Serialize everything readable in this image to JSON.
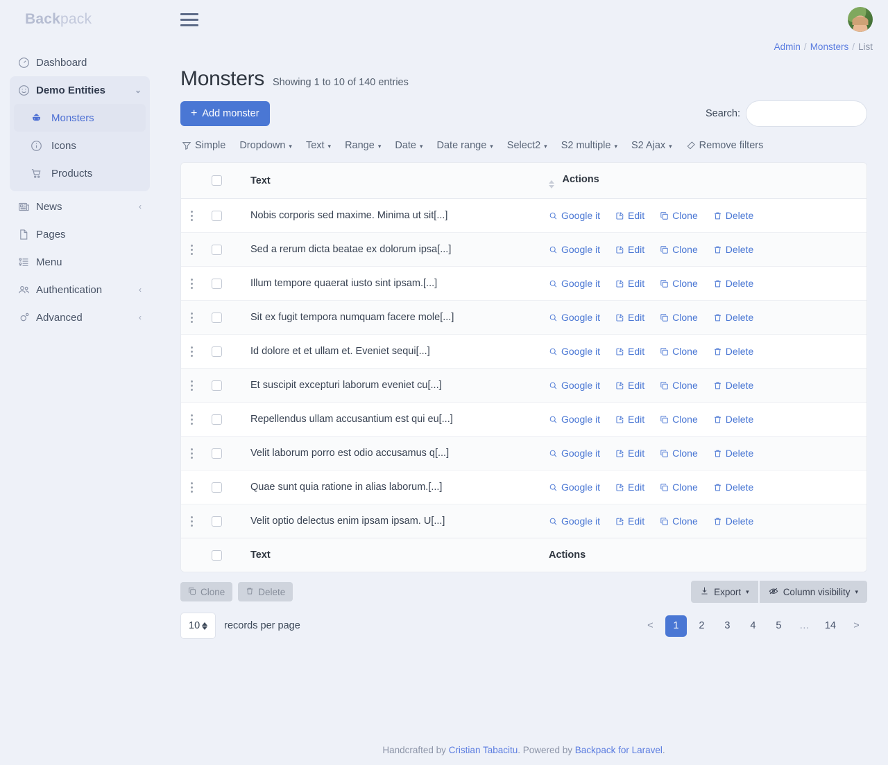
{
  "brand": {
    "strong": "Back",
    "light": "pack"
  },
  "sidebar": {
    "items": [
      {
        "label": "Dashboard",
        "icon": "dashboard-icon"
      },
      {
        "label": "Demo Entities",
        "icon": "smiley-icon",
        "caret": "⌄"
      },
      {
        "label": "News",
        "icon": "newspaper-icon",
        "caret": "‹"
      },
      {
        "label": "Pages",
        "icon": "file-icon"
      },
      {
        "label": "Menu",
        "icon": "list-icon"
      },
      {
        "label": "Authentication",
        "icon": "users-icon",
        "caret": "‹"
      },
      {
        "label": "Advanced",
        "icon": "gear-icon",
        "caret": "‹"
      }
    ],
    "demo_children": [
      {
        "label": "Monsters",
        "icon": "monster-icon",
        "active": true
      },
      {
        "label": "Icons",
        "icon": "info-circle-icon",
        "active": false
      },
      {
        "label": "Products",
        "icon": "cart-icon",
        "active": false
      }
    ]
  },
  "breadcrumb": {
    "admin": "Admin",
    "monsters": "Monsters",
    "current": "List",
    "separator": "/"
  },
  "header": {
    "title": "Monsters",
    "subtitle": "Showing 1 to 10 of 140 entries",
    "add_button": "Add monster",
    "add_plus": "+",
    "search_label": "Search:",
    "search_value": "",
    "search_placeholder": ""
  },
  "filters": [
    {
      "label": "Simple",
      "icon": "filter-icon",
      "caret": ""
    },
    {
      "label": "Dropdown",
      "caret": "▾"
    },
    {
      "label": "Text",
      "caret": "▾"
    },
    {
      "label": "Range",
      "caret": "▾"
    },
    {
      "label": "Date",
      "caret": "▾"
    },
    {
      "label": "Date range",
      "caret": "▾"
    },
    {
      "label": "Select2",
      "caret": "▾"
    },
    {
      "label": "S2 multiple",
      "caret": "▾"
    },
    {
      "label": "S2 Ajax",
      "caret": "▾"
    },
    {
      "label": "Remove filters",
      "icon": "eraser-icon",
      "caret": ""
    }
  ],
  "table": {
    "columns": {
      "text": "Text",
      "actions": "Actions"
    },
    "row_actions": [
      {
        "label": "Google it",
        "icon": "search-icon"
      },
      {
        "label": "Edit",
        "icon": "pencil-square-icon"
      },
      {
        "label": "Clone",
        "icon": "copy-icon"
      },
      {
        "label": "Delete",
        "icon": "trash-icon"
      }
    ],
    "rows": [
      {
        "text": "Nobis corporis sed maxime. Minima ut sit[...]"
      },
      {
        "text": "Sed a rerum dicta beatae ex dolorum ipsa[...]"
      },
      {
        "text": "Illum tempore quaerat iusto sint ipsam.[...]"
      },
      {
        "text": "Sit ex fugit tempora numquam facere mole[...]"
      },
      {
        "text": "Id dolore et et ullam et. Eveniet sequi[...]"
      },
      {
        "text": "Et suscipit excepturi laborum eveniet cu[...]"
      },
      {
        "text": "Repellendus ullam accusantium est qui eu[...]"
      },
      {
        "text": "Velit laborum porro est odio accusamus q[...]"
      },
      {
        "text": "Quae sunt quia ratione in alias laborum.[...]"
      },
      {
        "text": "Velit optio delectus enim ipsam ipsam. U[...]"
      }
    ]
  },
  "bulk": {
    "clone": "Clone",
    "delete": "Delete",
    "export": "Export",
    "column_visibility": "Column visibility",
    "caret": "▾"
  },
  "pagination": {
    "records_per_page_value": "10",
    "records_per_page_label": "records per page",
    "prev": "<",
    "next": ">",
    "gap": "…",
    "pages": [
      "1",
      "2",
      "3",
      "4",
      "5"
    ],
    "last_page": "14",
    "active_page": "1"
  },
  "footer": {
    "prefix": "Handcrafted by ",
    "author": "Cristian Tabacitu",
    "middle": ". Powered by ",
    "product": "Backpack for Laravel",
    "suffix": "."
  },
  "colors": {
    "accent": "#4a77d4",
    "link": "#5a7ce0",
    "page_bg": "#eef1f8"
  }
}
